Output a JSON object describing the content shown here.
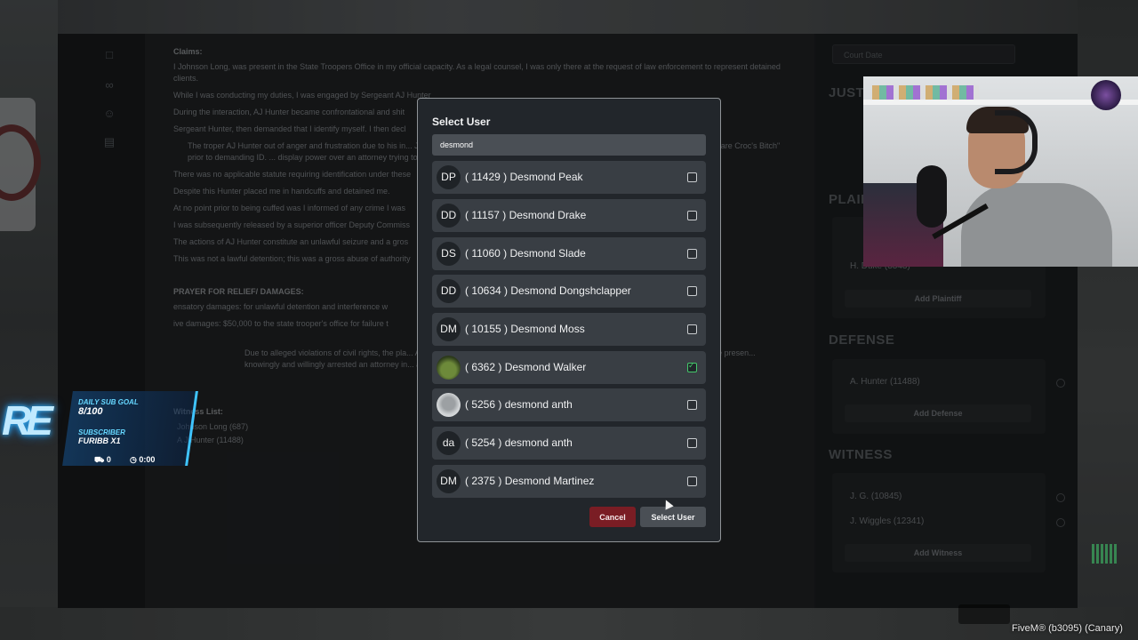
{
  "modal": {
    "title": "Select User",
    "search_value": "desmond",
    "users": [
      {
        "initials": "DP",
        "label": "( 11429 ) Desmond  Peak",
        "checked": false
      },
      {
        "initials": "DD",
        "label": "( 11157 ) Desmond  Drake",
        "checked": false
      },
      {
        "initials": "DS",
        "label": "( 11060 ) Desmond  Slade",
        "checked": false
      },
      {
        "initials": "DD",
        "label": "( 10634 ) Desmond  Dongshclapper",
        "checked": false
      },
      {
        "initials": "DM",
        "label": "( 10155 ) Desmond  Moss",
        "checked": false
      },
      {
        "initials": "",
        "label": "( 6362 ) Desmond  Walker",
        "checked": true
      },
      {
        "initials": "",
        "label": "( 5256 ) desmond  anth",
        "checked": false
      },
      {
        "initials": "da",
        "label": "( 5254 ) desmond  anth",
        "checked": false
      },
      {
        "initials": "DM",
        "label": "( 2375 ) Desmond  Martinez",
        "checked": false
      }
    ],
    "cancel_label": "Cancel",
    "select_label": "Select User"
  },
  "document": {
    "claims_label": "Claims:",
    "paragraphs": [
      "I Johnson Long, was present in the State Troopers Office in my official capacity. As a legal counsel, I was only there at the request of law enforcement to represent detained clients.",
      "While I was conducting my duties, I was engaged by Sergeant AJ Hunter",
      "During the interaction, AJ Hunter became confrontational and shit",
      "Sergeant Hunter, then demanded that I identify myself. I then decl",
      "There was no applicable statute requiring identification under these",
      "Despite this Hunter placed me in handcuffs and detained me.",
      "At no point prior to being cuffed was I informed of any crime I was",
      "I was subsequently released by a superior officer Deputy Commiss",
      "The actions of AJ Hunter constitute an unlawful seizure and a gros",
      "This was not a lawful detention; this was a gross abuse of authority"
    ],
    "quote": "The troper AJ Hunter out of anger and frustration due to his in... Johnson Long, for no apparent reason. I and AJ Hunter have h... Lees Bitch\" and \"you are Croc's Bitch\" prior to demanding ID. ... display power over an attorney trying to represent a client.",
    "prayer_label": "PRAYER FOR RELIEF/ DAMAGES:",
    "prayer_items": [
      "ensatory damages: for unlawful detention and interference w",
      "ive damages: $50,000 to the state trooper's office for failure t"
    ],
    "closing": "Due to alleged violations of civil rights, the pla... A J Hunter (11488)  as he knowingly conducte... Johnson Long without just cause in the presen... knowingly and willingly arrested an attorney in... advised by attorneys he is making a mistake. H... ID\" in the state of Los Santos.",
    "witness_label": "Witness List:",
    "witnesses": [
      "Johnson Long (687)",
      "A J Hunter (11488)"
    ]
  },
  "side": {
    "court_date_placeholder": "Court Date",
    "sections": {
      "justice": "JUSTIC",
      "plaintiff": "PLAINT",
      "defense": "DEFENSE",
      "witness": "WITNESS"
    },
    "plaintiff_entry": "H. Duke  (3343)",
    "add_plaintiff": "Add Plaintiff",
    "defense_entry": "A. Hunter  (11488)",
    "add_defense": "Add Defense",
    "witness_entries": [
      "J. G.  (10845)",
      "J. Wiggles  (12341)"
    ],
    "add_witness": "Add Witness"
  },
  "overlay": {
    "logo": "RE",
    "daily_sub_goal_label": "DAILY SUB GOAL",
    "daily_sub_goal_value": "8/100",
    "subscriber_label": "SUBSCRIBER",
    "subscriber_value": "FURIBB X1",
    "counter_a": "0",
    "counter_b": "0:00"
  },
  "fivem_label": "FiveM® (b3095) (Canary)"
}
